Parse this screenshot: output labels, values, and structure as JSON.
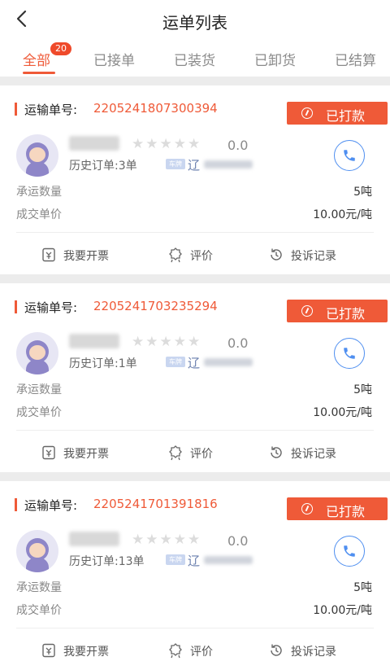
{
  "header": {
    "title": "运单列表"
  },
  "tabs": [
    {
      "label": "全部",
      "badge": "20"
    },
    {
      "label": "已接单"
    },
    {
      "label": "已装货"
    },
    {
      "label": "已卸货"
    },
    {
      "label": "已结算"
    }
  ],
  "labels": {
    "order_prefix": "运输单号:",
    "quantity": "承运数量",
    "price": "成交单价",
    "plate_tag": "车牌"
  },
  "orders": [
    {
      "order_no": "2205241807300394",
      "status": "已打款",
      "score": "0.0",
      "history": "历史订单:3单",
      "plate_prefix": "辽",
      "quantity": "5吨",
      "price": "10.00元/吨",
      "rating_stars": 0
    },
    {
      "order_no": "2205241703235294",
      "status": "已打款",
      "score": "0.0",
      "history": "历史订单:1单",
      "plate_prefix": "辽",
      "quantity": "5吨",
      "price": "10.00元/吨",
      "rating_stars": 0
    },
    {
      "order_no": "2205241701391816",
      "status": "已打款",
      "score": "0.0",
      "history": "历史订单:13单",
      "plate_prefix": "辽",
      "quantity": "5吨",
      "price": "10.00元/吨",
      "rating_stars": 0
    }
  ],
  "actions": {
    "invoice": "我要开票",
    "review": "评价",
    "complaint": "投诉记录"
  },
  "icons": {
    "back": "chevron-left-icon",
    "paid": "money-icon",
    "phone": "phone-icon",
    "invoice": "invoice-icon",
    "review": "badge-icon",
    "complaint": "history-icon"
  },
  "colors": {
    "accent": "#ef5a38",
    "phone": "#4f8ff0"
  }
}
